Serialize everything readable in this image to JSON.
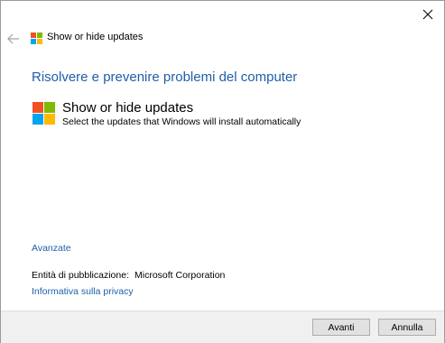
{
  "window": {
    "nav_title": "Show or hide updates",
    "close_icon": "close-icon",
    "back_icon": "back-arrow-icon"
  },
  "main": {
    "page_title": "Risolvere e prevenire problemi del computer",
    "entry": {
      "title": "Show or hide updates",
      "description": "Select the updates that Windows will install automatically",
      "icon": "windows-logo-icon"
    },
    "advanced_link": "Avanzate",
    "publisher_label": "Entità di pubblicazione:",
    "publisher_value": "Microsoft Corporation",
    "privacy_link": "Informativa sulla privacy"
  },
  "footer": {
    "next_label": "Avanti",
    "cancel_label": "Annulla"
  },
  "colors": {
    "link": "#1f5fa8",
    "logo_red": "#f25022",
    "logo_green": "#7fba00",
    "logo_blue": "#00a4ef",
    "logo_yellow": "#ffb900"
  }
}
